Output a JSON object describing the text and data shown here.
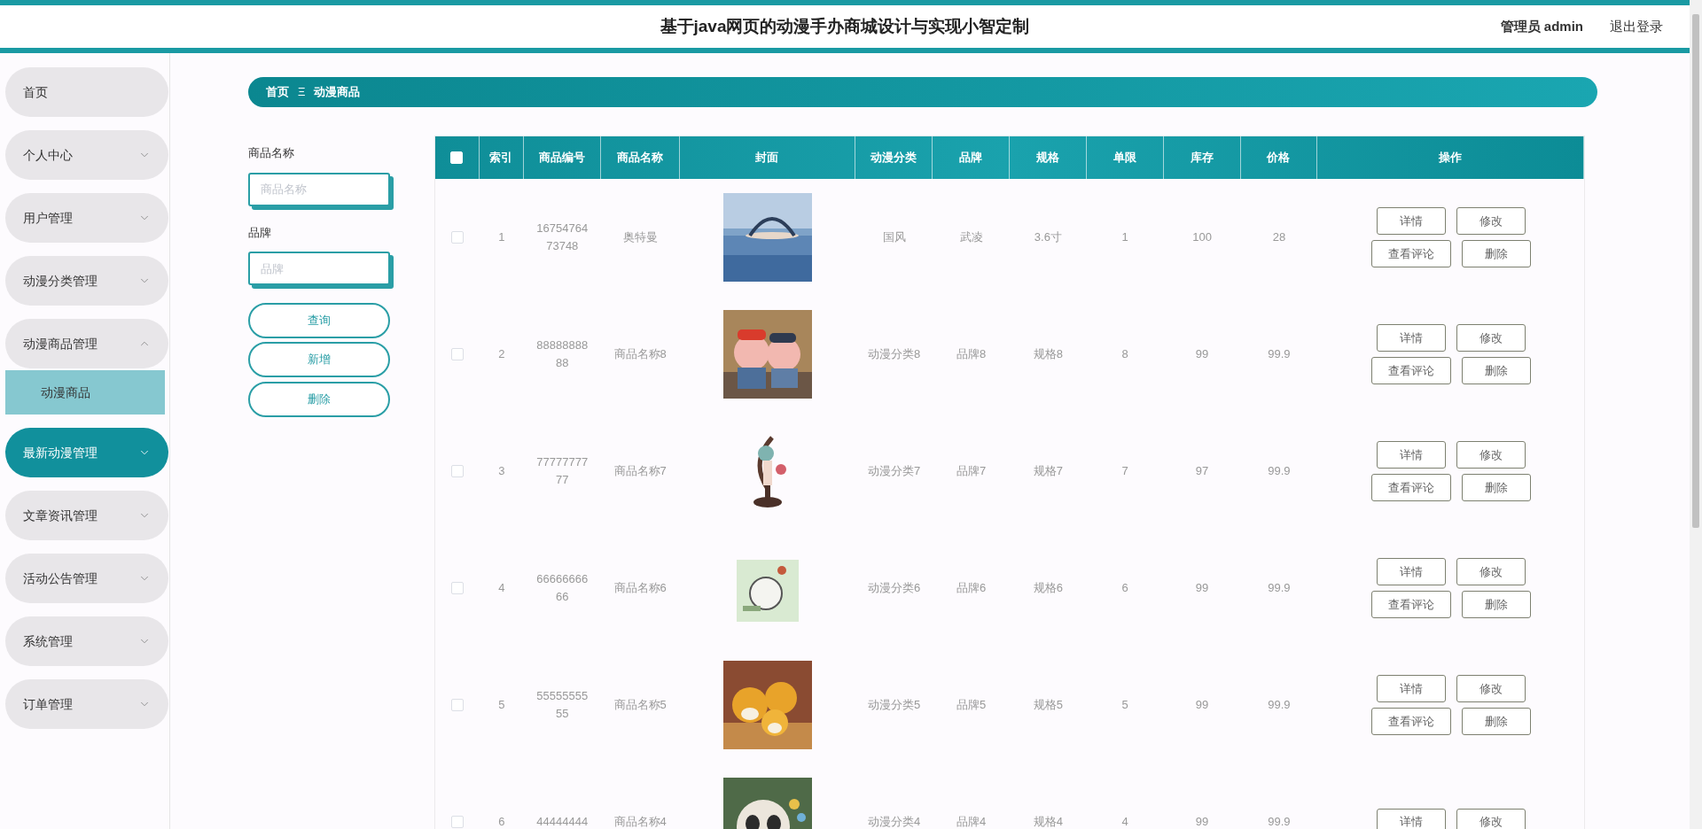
{
  "header": {
    "title": "基于java网页的动漫手办商城设计与实现小智定制",
    "user": "管理员 admin",
    "logout": "退出登录"
  },
  "sidebar": {
    "items": [
      {
        "label": "首页",
        "kind": "link",
        "selected": false
      },
      {
        "label": "个人中心",
        "kind": "group",
        "expanded": false,
        "selected": false
      },
      {
        "label": "用户管理",
        "kind": "group",
        "expanded": false,
        "selected": false
      },
      {
        "label": "动漫分类管理",
        "kind": "group",
        "expanded": false,
        "selected": false
      },
      {
        "label": "动漫商品管理",
        "kind": "group",
        "expanded": true,
        "selected": false,
        "children": [
          {
            "label": "动漫商品",
            "selected": true
          }
        ]
      },
      {
        "label": "最新动漫管理",
        "kind": "group",
        "expanded": false,
        "selected": true
      },
      {
        "label": "文章资讯管理",
        "kind": "group",
        "expanded": false,
        "selected": false
      },
      {
        "label": "活动公告管理",
        "kind": "group",
        "expanded": false,
        "selected": false
      },
      {
        "label": "系统管理",
        "kind": "group",
        "expanded": false,
        "selected": false
      },
      {
        "label": "订单管理",
        "kind": "group",
        "expanded": false,
        "selected": false
      }
    ]
  },
  "breadcrumb": {
    "home": "首页",
    "separator": "Ξ",
    "current": "动漫商品"
  },
  "filters": [
    {
      "label": "商品名称",
      "placeholder": "商品名称"
    },
    {
      "label": "品牌",
      "placeholder": "品牌"
    }
  ],
  "buttons": [
    "查询",
    "新增",
    "删除"
  ],
  "table": {
    "select_all": {
      "checked": false
    },
    "columns": [
      "索引",
      "商品编号",
      "商品名称",
      "封面",
      "动漫分类",
      "品牌",
      "规格",
      "单限",
      "库存",
      "价格",
      "操作"
    ],
    "rows": [
      {
        "checked": false,
        "cells": [
          "1",
          "1675476473748",
          "奥特曼",
          {
            "kind": "picture"
          },
          "国风",
          "武凌",
          "3.6寸",
          "1",
          "100",
          "28"
        ],
        "actions": [
          "详情",
          "修改",
          "查看评论",
          "删除"
        ]
      },
      {
        "checked": false,
        "cells": [
          "2",
          "8888888888",
          "商品名称8",
          {
            "kind": "picture"
          },
          "动漫分类8",
          "品牌8",
          "规格8",
          "8",
          "99",
          "99.9"
        ],
        "actions": [
          "详情",
          "修改",
          "查看评论",
          "删除"
        ]
      },
      {
        "checked": false,
        "cells": [
          "3",
          "7777777777",
          "商品名称7",
          {
            "kind": "picture"
          },
          "动漫分类7",
          "品牌7",
          "规格7",
          "7",
          "97",
          "99.9"
        ],
        "actions": [
          "详情",
          "修改",
          "查看评论",
          "删除"
        ]
      },
      {
        "checked": false,
        "cells": [
          "4",
          "6666666666",
          "商品名称6",
          {
            "kind": "picture"
          },
          "动漫分类6",
          "品牌6",
          "规格6",
          "6",
          "99",
          "99.9"
        ],
        "actions": [
          "详情",
          "修改",
          "查看评论",
          "删除"
        ]
      },
      {
        "checked": false,
        "cells": [
          "5",
          "5555555555",
          "商品名称5",
          {
            "kind": "picture"
          },
          "动漫分类5",
          "品牌5",
          "规格5",
          "5",
          "99",
          "99.9"
        ],
        "actions": [
          "详情",
          "修改",
          "查看评论",
          "删除"
        ]
      },
      {
        "checked": false,
        "cells": [
          "6",
          "44444444",
          "商品名称4",
          {
            "kind": "picture"
          },
          "动漫分类4",
          "品牌4",
          "规格4",
          "4",
          "99",
          "99.9"
        ],
        "actions": [
          "详情",
          "修改"
        ]
      }
    ]
  }
}
